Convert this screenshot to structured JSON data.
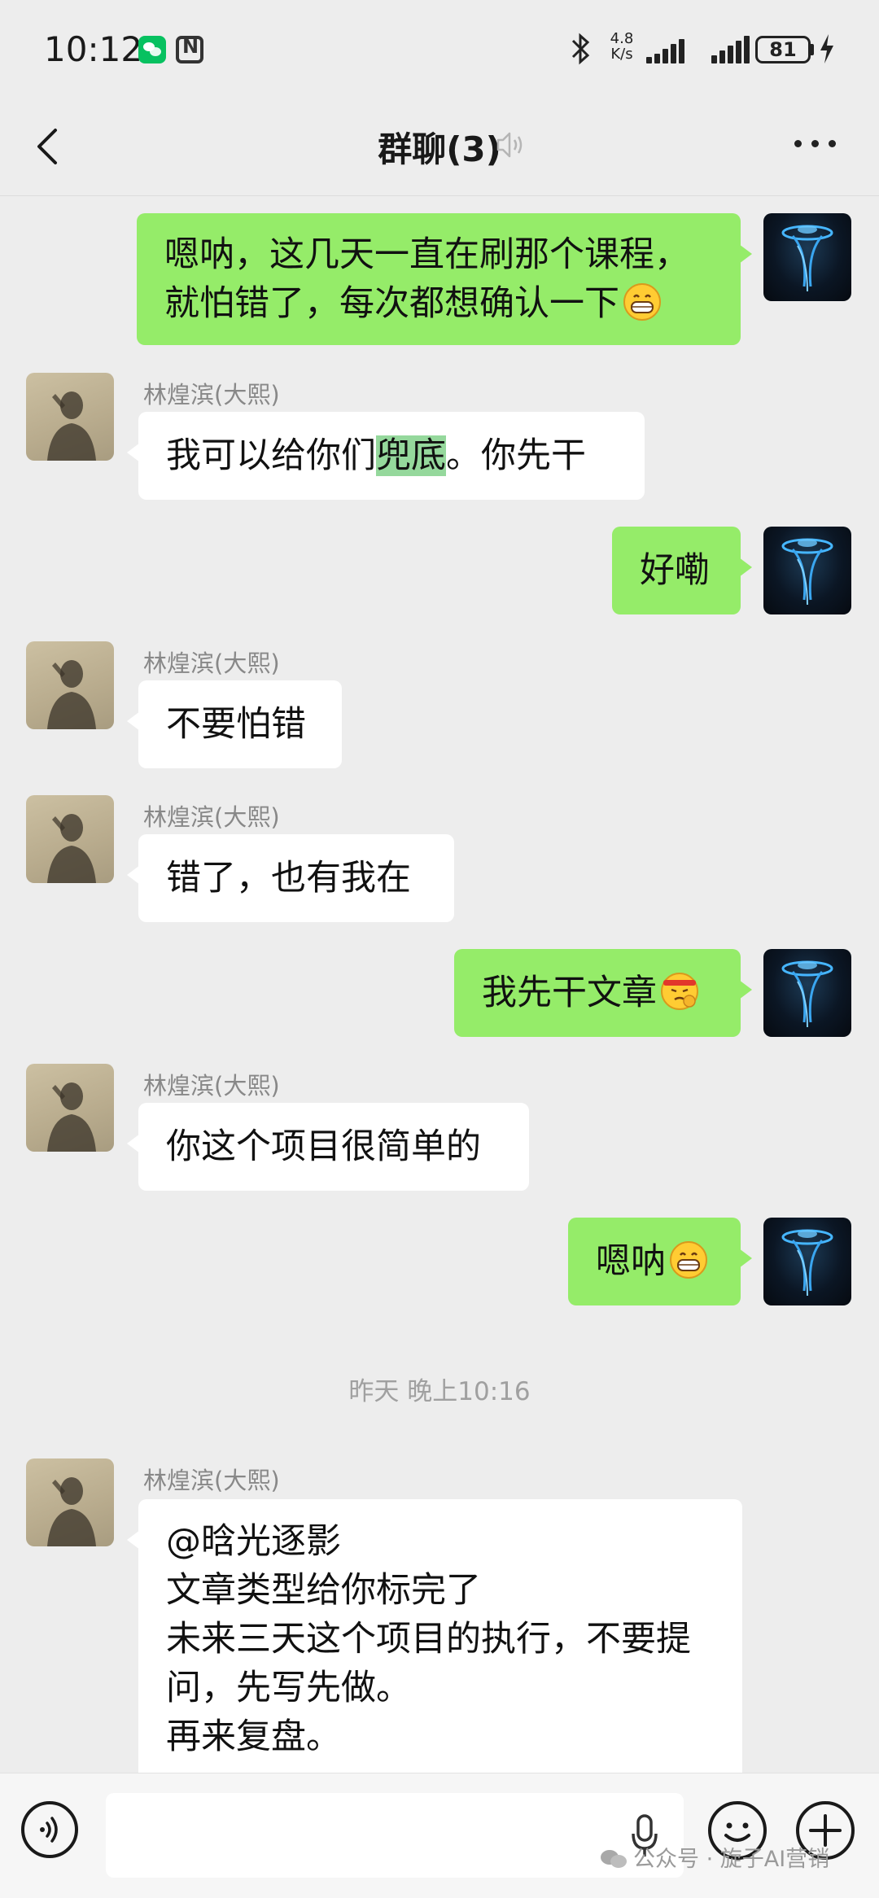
{
  "status_bar": {
    "time": "10:12",
    "net_speed_value": "4.8",
    "net_speed_unit": "K/s",
    "battery_level": "81",
    "icons": [
      "wechat-notification-icon",
      "nfc-icon",
      "bluetooth-icon",
      "signal-icon",
      "battery-icon",
      "charging-icon"
    ]
  },
  "header": {
    "title": "群聊(3)",
    "icons": [
      "back-icon",
      "mute-icon",
      "more-icon"
    ]
  },
  "messages": [
    {
      "from": "self",
      "lines": [
        "嗯呐，这几天一直在刷那个课程，",
        "就怕错了，每次都想确认一下"
      ],
      "emoji": "grin-emoji"
    },
    {
      "from": "other",
      "sender": "林煌滨(大熙)",
      "text_before": "我可以给你们",
      "highlight": "兜底",
      "text_after": "。你先干"
    },
    {
      "from": "self",
      "text": "好嘞"
    },
    {
      "from": "other",
      "sender": "林煌滨(大熙)",
      "text": "不要怕错"
    },
    {
      "from": "other",
      "sender": "林煌滨(大熙)",
      "text": "错了，也有我在"
    },
    {
      "from": "self",
      "text": "我先干文章",
      "emoji": "determined-emoji"
    },
    {
      "from": "other",
      "sender": "林煌滨(大熙)",
      "text": "你这个项目很简单的"
    },
    {
      "from": "self",
      "text": "嗯呐",
      "emoji": "grin-emoji"
    },
    {
      "from": "other",
      "sender": "林煌滨(大熙)",
      "lines": [
        "@晗光逐影",
        "文章类型给你标完了",
        "未来三天这个项目的执行，不要提",
        "问，先写先做。",
        "再来复盘。"
      ]
    }
  ],
  "timestamp": "昨天 晚上10:16",
  "input_bar": {
    "placeholder": "",
    "icons": [
      "voice-icon",
      "mic-icon",
      "emoji-icon",
      "plus-icon"
    ]
  },
  "watermark": "公众号 · 旋子AI营销",
  "colors": {
    "background": "#ededed",
    "self_bubble": "#95ec69",
    "other_bubble": "#ffffff",
    "highlight": "#95d89c"
  }
}
